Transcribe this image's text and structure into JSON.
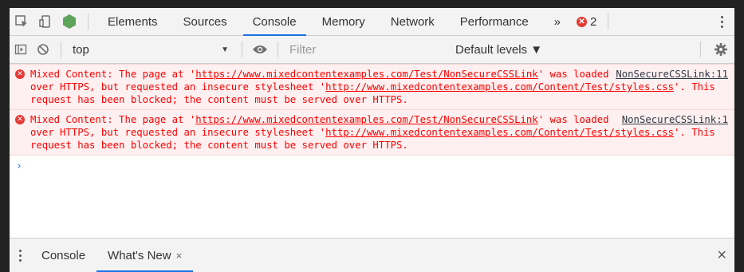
{
  "tabs": {
    "items": [
      "Elements",
      "Sources",
      "Console",
      "Memory",
      "Network",
      "Performance"
    ],
    "active": "Console",
    "more": "»",
    "error_count": "2"
  },
  "console_toolbar": {
    "context": "top",
    "filter_placeholder": "Filter",
    "levels": "Default levels ▼"
  },
  "messages": [
    {
      "prefix": "Mixed Content: The page at '",
      "page_url": "https://www.mixedcontentexamples.com/Test/NonSecureCSSLink",
      "mid": "' was loaded over HTTPS, but requested an insecure stylesheet '",
      "css_url": "http://www.mixedcontentexamples.com/Content/Test/styles.css",
      "suffix": "'. This request has been blocked; the content must be served over HTTPS.",
      "source": "NonSecureCSSLink:11"
    },
    {
      "prefix": "Mixed Content: The page at '",
      "page_url": "https://www.mixedcontentexamples.com/Test/NonSecureCSSLink",
      "mid": "' was loaded over HTTPS, but requested an insecure stylesheet '",
      "css_url": "http://www.mixedcontentexamples.com/Content/Test/styles.css",
      "suffix": "'. This request has been blocked; the content must be served over HTTPS.",
      "source": "NonSecureCSSLink:1"
    }
  ],
  "prompt": "›",
  "drawer": {
    "tabs": [
      "Console",
      "What's New"
    ],
    "active": "What's New",
    "tab_close": "×",
    "close": "×"
  }
}
